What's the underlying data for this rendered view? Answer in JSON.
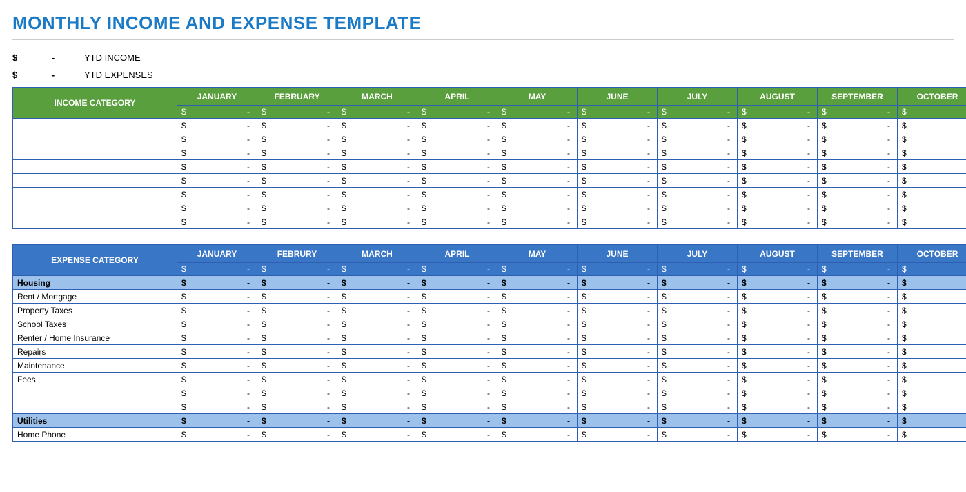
{
  "title": "MONTHLY INCOME AND EXPENSE TEMPLATE",
  "summary": {
    "income_label": "YTD INCOME",
    "expenses_label": "YTD EXPENSES",
    "dollar": "$",
    "dash": "-"
  },
  "months_income": [
    "JANUARY",
    "FEBRUARY",
    "MARCH",
    "APRIL",
    "MAY",
    "JUNE",
    "JULY",
    "AUGUST",
    "SEPTEMBER",
    "OCTOBER"
  ],
  "months_expense": [
    "JANUARY",
    "FEBRURY",
    "MARCH",
    "APRIL",
    "MAY",
    "JUNE",
    "JULY",
    "AUGUST",
    "SEPTEMBER",
    "OCTOBER"
  ],
  "income_header": "INCOME CATEGORY",
  "expense_header": "EXPENSE CATEGORY",
  "empty_cell": {
    "sign": "$",
    "value": "-"
  },
  "income_rows": [
    "",
    "",
    "",
    "",
    "",
    "",
    "",
    ""
  ],
  "expense_sections": [
    {
      "group": "Housing",
      "items": [
        "Rent / Mortgage",
        "Property Taxes",
        "School Taxes",
        "Renter / Home Insurance",
        "Repairs",
        "Maintenance",
        "Fees",
        "",
        ""
      ]
    },
    {
      "group": "Utilities",
      "items": [
        "Home Phone"
      ]
    }
  ]
}
